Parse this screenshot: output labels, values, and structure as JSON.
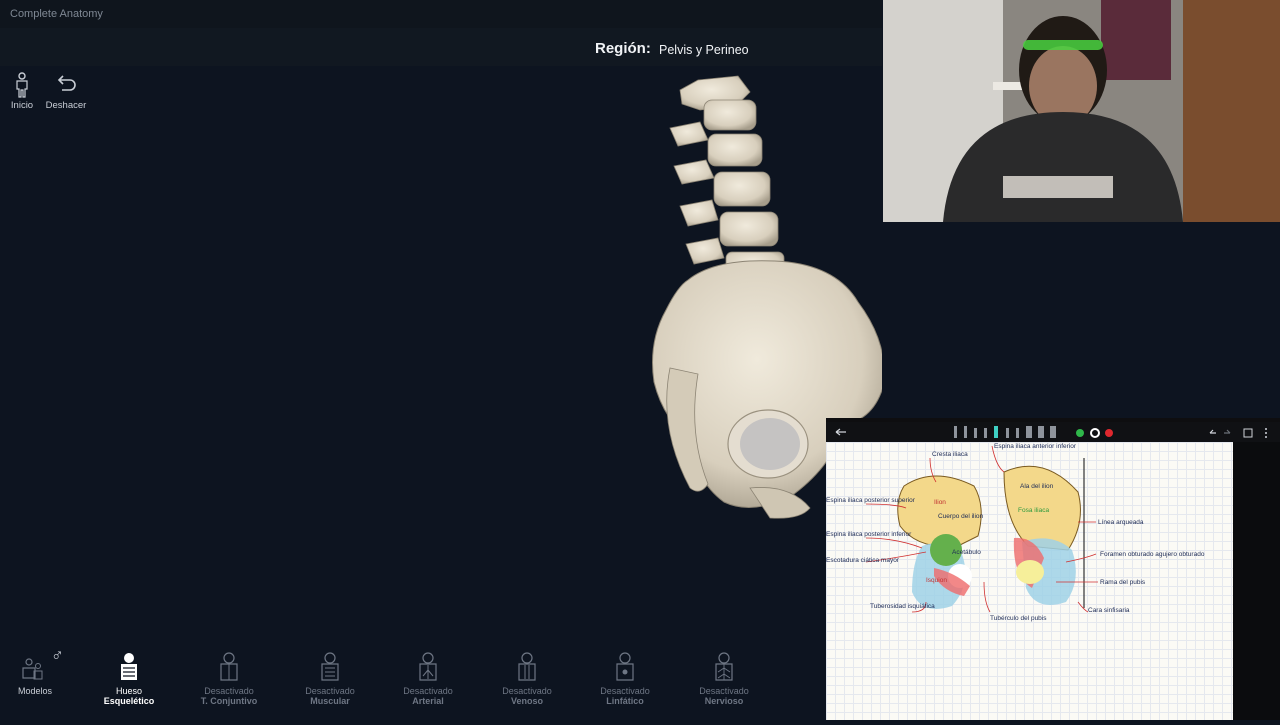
{
  "app": {
    "title": "Complete Anatomy"
  },
  "region": {
    "label": "Región:",
    "value": "Pelvis y Perineo"
  },
  "tools": [
    {
      "label": "Inicio",
      "icon": "person-icon"
    },
    {
      "label": "Deshacer",
      "icon": "undo-icon"
    }
  ],
  "models": {
    "label": "Modelos",
    "gender_symbol": "♂"
  },
  "layers": [
    {
      "line1": "Hueso",
      "line2": "Esquelético",
      "active": true
    },
    {
      "line1": "Desactivado",
      "line2": "T. Conjuntivo",
      "active": false
    },
    {
      "line1": "Desactivado",
      "line2": "Muscular",
      "active": false
    },
    {
      "line1": "Desactivado",
      "line2": "Arterial",
      "active": false
    },
    {
      "line1": "Desactivado",
      "line2": "Venoso",
      "active": false
    },
    {
      "line1": "Desactivado",
      "line2": "Linfático",
      "active": false
    },
    {
      "line1": "Desactivado",
      "line2": "Nervioso",
      "active": false
    }
  ],
  "notes": {
    "labels": [
      "Cresta iliaca",
      "Espina iliaca anterior inferior",
      "Espina iliaca posterior superior",
      "Espina iliaca posterior inferior",
      "Escotadura ciática mayor",
      "Ilion",
      "Cuerpo del ilion",
      "Acetábulo",
      "Isquion",
      "Ala del ilion",
      "Fosa iliaca",
      "Línea arqueada",
      "Foramen obturado agujero obturado",
      "Rama del pubis",
      "Tuberosidad isquiática",
      "Tubérculo del pubis",
      "Cara sinfisaria"
    ],
    "toolbar_colors": [
      "#2fb84a",
      "#ffffff",
      "#e0282e"
    ]
  }
}
